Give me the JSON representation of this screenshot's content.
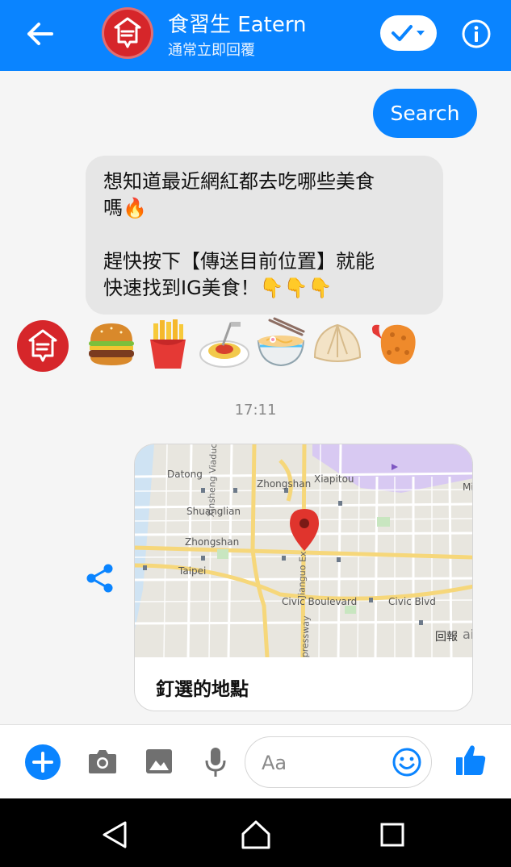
{
  "header": {
    "title": "食習生 Eatern",
    "subtitle": "通常立即回覆",
    "back_icon": "arrow-left-icon",
    "check_icon": "check-dropdown-icon",
    "info_icon": "info-icon"
  },
  "chat": {
    "search_bubble": "Search",
    "bot_message": {
      "line1": "想知道最近網紅都去吃哪些美食",
      "line2": "嗎🔥",
      "line3": "趕快按下【傳送目前位置】就能",
      "line4": "快速找到IG美食！👇👇👇"
    },
    "emoji_row": [
      "🍔",
      "🍟",
      "🍝",
      "🍜",
      "🥟",
      "🍤"
    ],
    "timestamp": "17:11",
    "location_card": {
      "caption": "釘選的地點",
      "map_labels": {
        "datong": "Datong",
        "zhongshan_n": "Zhongshan",
        "xiapitou": "Xiapitou",
        "shuanglian": "Shuanglian",
        "zhongshan_w": "Zhongshan",
        "taipei": "Taipei",
        "xinsheng": "Xinsheng Viaduct",
        "jianguo": "Jianguo Ex",
        "civic_blvd": "Civic Boulevard",
        "civic_blvd_short": "Civic Blvd",
        "expressway": "pressway",
        "mi": "Mi",
        "report": "回報",
        "ai": "ai"
      }
    }
  },
  "composer": {
    "placeholder": "Aa",
    "icons": [
      "plus-icon",
      "camera-icon",
      "image-icon",
      "microphone-icon",
      "smiley-icon",
      "thumbs-up-icon"
    ]
  },
  "colors": {
    "brand_blue": "#0a84ff",
    "brand_red": "#d6262a",
    "bubble_gray": "#e6e6e6"
  }
}
